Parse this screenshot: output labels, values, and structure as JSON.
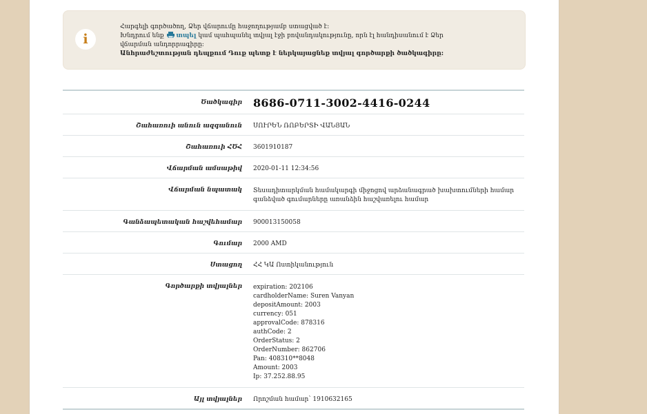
{
  "info": {
    "line1": "Հարգելի գործածող, Ձեր վճարումը հաջողությամբ ստացված է:",
    "line2_before": "Խնդրում ենք",
    "print_label": "տպել",
    "line2_after": "կամ պահպանել տվյալ էջի բովանդակությունը, որն էլ հանդիսանում է Ձեր",
    "line3": "վճարման անդորրագիրը:",
    "line4": "Անհրաժեշտության դեպքում Դուք պետք է ներկայացնեք տվյալ գործարքի ծածկագիրը:"
  },
  "details": {
    "code_label": "Ծածկագիր",
    "code_value": "8686-0711-3002-4416-0244",
    "payer_name_label": "Շահառուի անուն ազգանուն",
    "payer_name_value": "ՍՈՒՐԵՆ ՌՈԲԵՐՏԻ ՎԱՆՅԱՆ",
    "payer_id_label": "Շահառուի ՀԾՀ",
    "payer_id_value": "3601910187",
    "date_label": "Վճարման ամսաթիվ",
    "date_value": "2020-01-11 12:34:56",
    "purpose_label": "Վճարման նպատակ",
    "purpose_line1": "Տեսադիտարկման համակարգի միջոցով արձանագրած խախտումների համար",
    "purpose_line2": "գանձված գումարները առանձին հաշվառելու համար",
    "account_label": "Գանձապետական հաշվեհամար",
    "account_value": "900013150058",
    "amount_label": "Գումար",
    "amount_value": "2000 AMD",
    "recipient_label": "Ստացող",
    "recipient_value": "ՀՀ ԿԱ Ոստիկանություն",
    "transaction_label": "Գործարքի տվյալներ",
    "transaction_lines": [
      "expiration: 202106",
      "cardholderName: Suren Vanyan",
      "depositAmount: 2003",
      "currency: 051",
      "approvalCode: 878316",
      "authCode: 2",
      "OrderStatus: 2",
      "OrderNumber: 862706",
      "Pan: 408310**8048",
      "Amount: 2003",
      "Ip: 37.252.88.95"
    ],
    "other_label": "Այլ տվյալներ",
    "other_value": "Որոշման համար՝ 1910632165"
  },
  "colors": {
    "background": "#e3d2b8",
    "info_box": "#f1ece3",
    "info_icon": "#c77f1a",
    "link": "#2a7a9a",
    "table_border": "#c6d3d6"
  },
  "icons": {
    "info": "info-icon",
    "print": "printer-icon"
  }
}
